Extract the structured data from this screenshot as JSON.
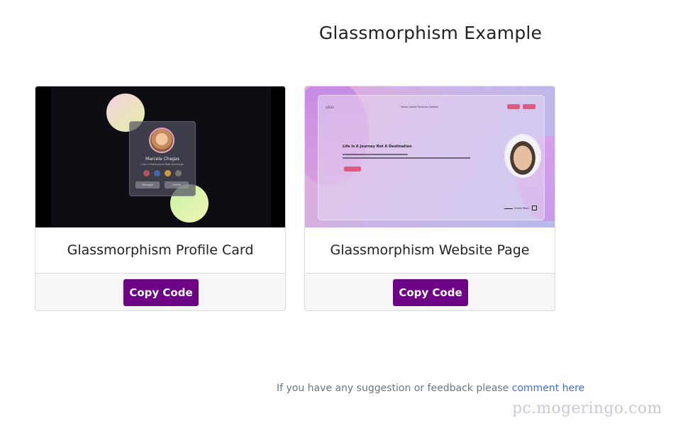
{
  "page": {
    "title": "Glassmorphism Example"
  },
  "cards": [
    {
      "title": "Glassmorphism Profile Card",
      "button_label": "Copy Code",
      "thumbnail": {
        "name": "Marcela Chagas",
        "subtitle": "I am a Professional Web Developer",
        "buttons": [
          "Message",
          "Follow"
        ]
      }
    },
    {
      "title": "Glassmorphism Website Page",
      "button_label": "Copy Code",
      "thumbnail": {
        "logo": "LOGO",
        "nav": "Home  Latest  Services  Contact",
        "headline": "Life Is A Journey Not A Destination",
        "cta": "Check More"
      }
    }
  ],
  "footer": {
    "text": "If you have any suggestion or feedback please ",
    "link_text": "comment here"
  },
  "watermark": "pc.mogeringo.com",
  "colors": {
    "button": "#6c0485",
    "link": "#3b6fd4",
    "accent_pink": "#e2597d"
  }
}
